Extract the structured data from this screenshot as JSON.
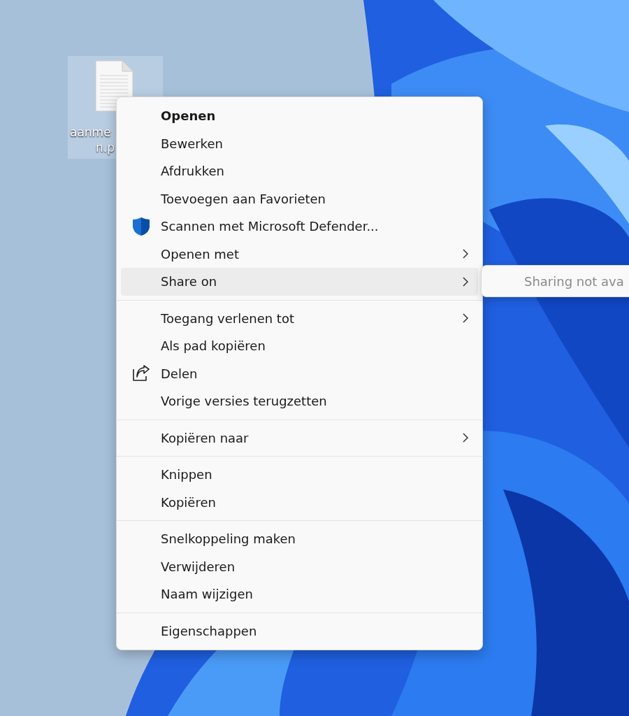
{
  "desktop_icon": {
    "label_lines": [
      "aanme",
      "n.p"
    ],
    "selected": true
  },
  "context_menu": {
    "items": [
      {
        "kind": "item",
        "label": "Openen",
        "bold": true,
        "submenu": false,
        "selected": false
      },
      {
        "kind": "item",
        "label": "Bewerken",
        "bold": false,
        "submenu": false,
        "selected": false
      },
      {
        "kind": "item",
        "label": "Afdrukken",
        "bold": false,
        "submenu": false,
        "selected": false
      },
      {
        "kind": "item",
        "label": "Toevoegen aan Favorieten",
        "bold": false,
        "submenu": false,
        "selected": false
      },
      {
        "kind": "scan",
        "label": "Scannen met Microsoft Defender...",
        "bold": false,
        "submenu": false,
        "selected": false
      },
      {
        "kind": "item",
        "label": "Openen met",
        "bold": false,
        "submenu": true,
        "selected": false
      },
      {
        "kind": "item",
        "label": "Share on",
        "bold": false,
        "submenu": true,
        "selected": true
      },
      {
        "kind": "separator"
      },
      {
        "kind": "item",
        "label": "Toegang verlenen tot",
        "bold": false,
        "submenu": true,
        "selected": false
      },
      {
        "kind": "item",
        "label": "Als pad kopiëren",
        "bold": false,
        "submenu": false,
        "selected": false
      },
      {
        "kind": "share",
        "label": "Delen",
        "bold": false,
        "submenu": false,
        "selected": false
      },
      {
        "kind": "item",
        "label": "Vorige versies terugzetten",
        "bold": false,
        "submenu": false,
        "selected": false
      },
      {
        "kind": "separator"
      },
      {
        "kind": "item",
        "label": "Kopiëren naar",
        "bold": false,
        "submenu": true,
        "selected": false
      },
      {
        "kind": "separator"
      },
      {
        "kind": "item",
        "label": "Knippen",
        "bold": false,
        "submenu": false,
        "selected": false
      },
      {
        "kind": "item",
        "label": "Kopiëren",
        "bold": false,
        "submenu": false,
        "selected": false
      },
      {
        "kind": "separator"
      },
      {
        "kind": "item",
        "label": "Snelkoppeling maken",
        "bold": false,
        "submenu": false,
        "selected": false
      },
      {
        "kind": "item",
        "label": "Verwijderen",
        "bold": false,
        "submenu": false,
        "selected": false
      },
      {
        "kind": "item",
        "label": "Naam wijzigen",
        "bold": false,
        "submenu": false,
        "selected": false
      },
      {
        "kind": "separator"
      },
      {
        "kind": "item",
        "label": "Eigenschappen",
        "bold": false,
        "submenu": false,
        "selected": false
      }
    ]
  },
  "submenu": {
    "message": "Sharing not ava",
    "disabled": true
  }
}
